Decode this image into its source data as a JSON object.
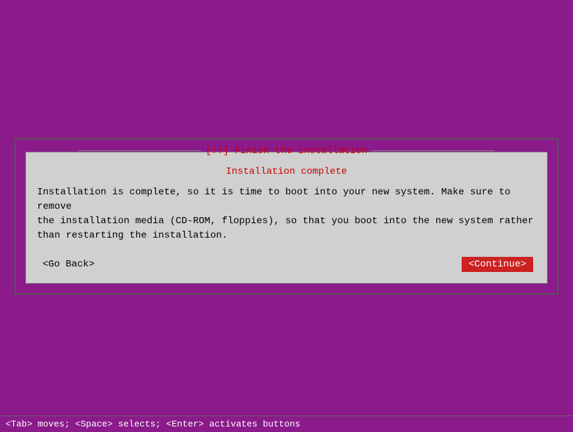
{
  "background_color": "#8B1A8B",
  "dialog": {
    "title": "[!!] Finish the installation",
    "subtitle": "Installation complete",
    "body_text": "Installation is complete, so it is time to boot into your new system. Make sure to remove\nthe installation media (CD-ROM, floppies), so that you boot into the new system rather\nthan restarting the installation.",
    "btn_go_back": "<Go Back>",
    "btn_continue": "<Continue>"
  },
  "bottom_bar": {
    "text": "<Tab> moves; <Space> selects; <Enter> activates buttons"
  }
}
